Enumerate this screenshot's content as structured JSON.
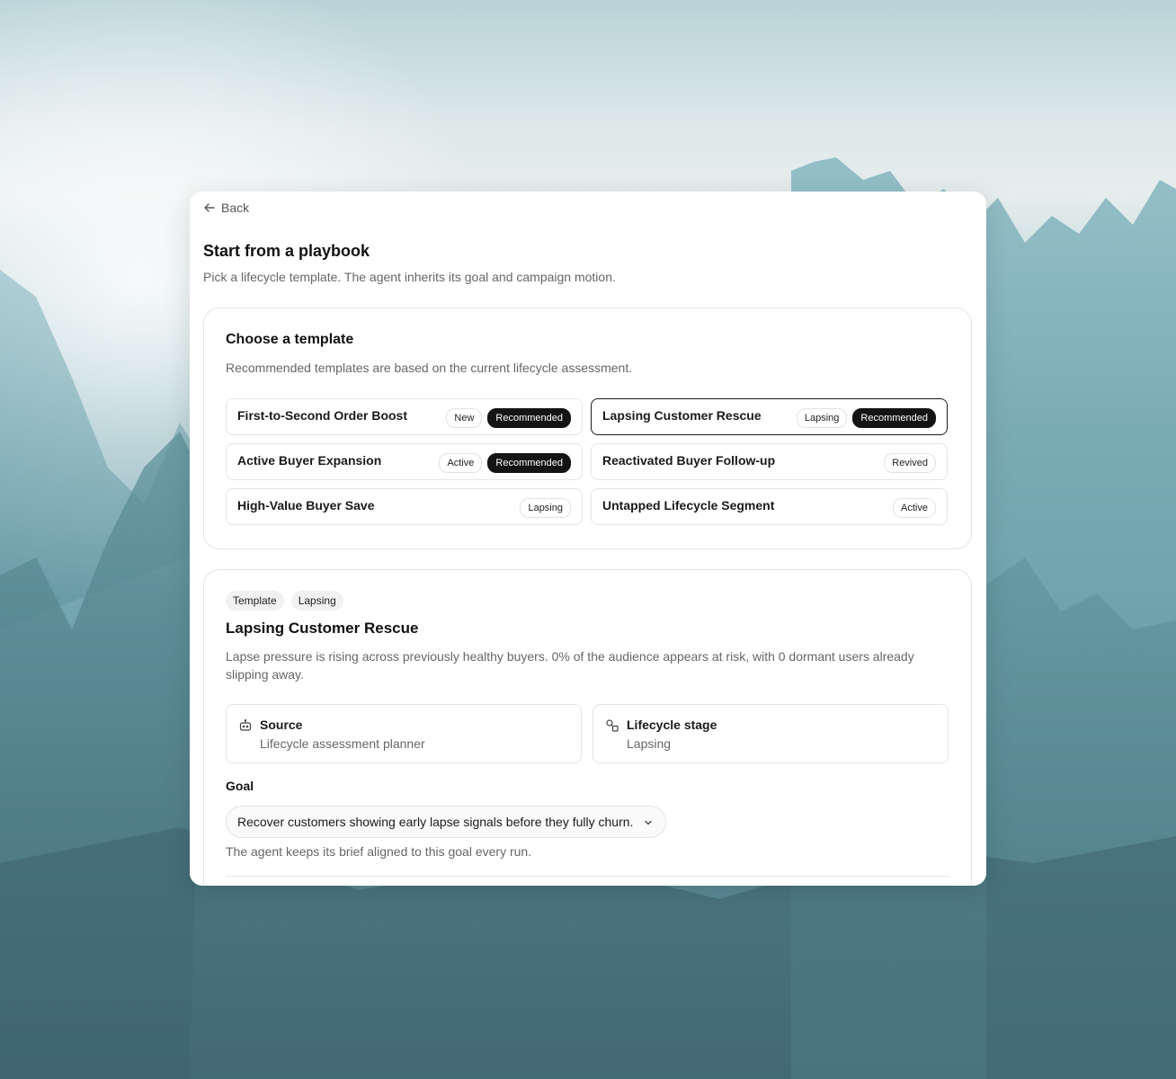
{
  "header": {
    "back_label": "Back",
    "title": "Start from a playbook",
    "subtitle": "Pick a lifecycle template. The agent inherits its goal and campaign motion."
  },
  "templates_panel": {
    "title": "Choose a template",
    "subtitle": "Recommended templates are based on the current lifecycle assessment.",
    "items": [
      {
        "name": "First-to-Second Order Boost",
        "stage": "New",
        "recommended": "Recommended",
        "selected": false
      },
      {
        "name": "Lapsing Customer Rescue",
        "stage": "Lapsing",
        "recommended": "Recommended",
        "selected": true
      },
      {
        "name": "Active Buyer Expansion",
        "stage": "Active",
        "recommended": "Recommended",
        "selected": false
      },
      {
        "name": "Reactivated Buyer Follow-up",
        "stage": "Revived",
        "recommended": "",
        "selected": false
      },
      {
        "name": "High-Value Buyer Save",
        "stage": "Lapsing",
        "recommended": "",
        "selected": false
      },
      {
        "name": "Untapped Lifecycle Segment",
        "stage": "Active",
        "recommended": "",
        "selected": false
      }
    ]
  },
  "detail": {
    "chips": [
      "Template",
      "Lapsing"
    ],
    "title": "Lapsing Customer Rescue",
    "description": "Lapse pressure is rising across previously healthy buyers. 0% of the audience appears at risk, with 0 dormant users already slipping away.",
    "source": {
      "label": "Source",
      "value": "Lifecycle assessment planner",
      "icon": "robot-icon"
    },
    "stage": {
      "label": "Lifecycle stage",
      "value": "Lapsing",
      "icon": "stage-shapes-icon"
    },
    "goal_label": "Goal",
    "goal_value": "Recover customers showing early lapse signals before they fully churn.",
    "goal_help": "The agent keeps its brief aligned to this goal every run."
  }
}
